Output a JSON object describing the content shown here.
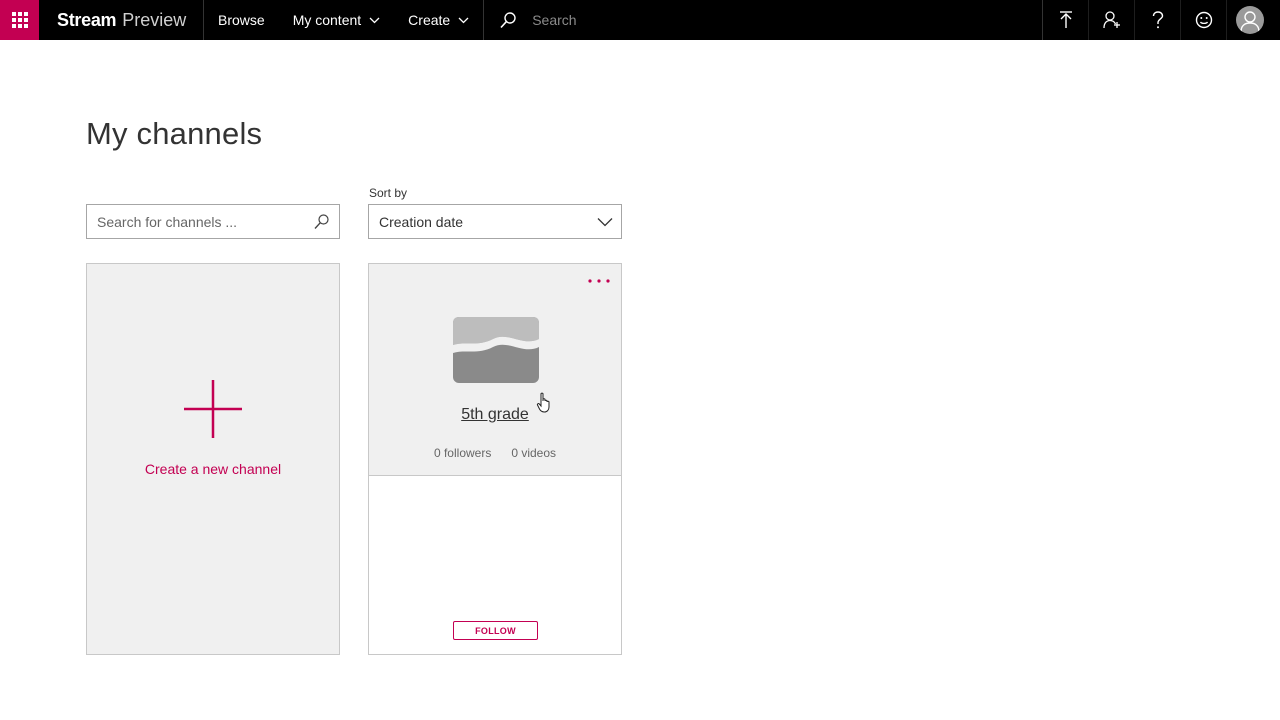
{
  "header": {
    "brand_bold": "Stream",
    "brand_light": "Preview",
    "nav": {
      "browse": "Browse",
      "my_content": "My content",
      "create": "Create"
    },
    "search_placeholder": "Search",
    "icons": [
      "upload-icon",
      "person-add-icon",
      "help-icon",
      "feedback-smiley-icon",
      "avatar-icon"
    ]
  },
  "main": {
    "title": "My channels",
    "search": {
      "placeholder": "Search for channels ..."
    },
    "sort": {
      "label": "Sort by",
      "value": "Creation date"
    },
    "create_card": {
      "label": "Create a new channel"
    },
    "channels": [
      {
        "name": "5th grade",
        "followers": "0 followers",
        "videos": "0 videos",
        "follow_label": "FOLLOW"
      }
    ]
  },
  "colors": {
    "accent": "#c30052",
    "topbar": "#000000",
    "card_bg": "#f0f0f0"
  }
}
